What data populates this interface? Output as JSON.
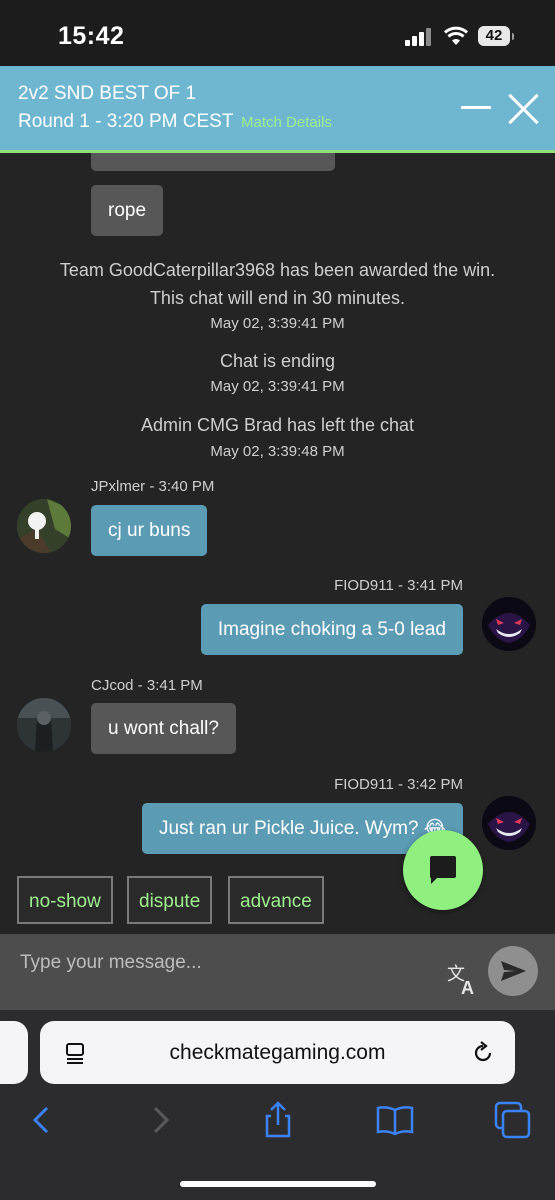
{
  "status_bar": {
    "time": "15:42",
    "battery": "42"
  },
  "header": {
    "title": "2v2 SND BEST OF 1",
    "round": "Round 1 - 3:20 PM CEST",
    "details_link": "Match Details"
  },
  "messages": {
    "rope": "rope",
    "sys_win_line1": "Team GoodCaterpillar3968 has been awarded the win.",
    "sys_win_line2": "This chat will end in 30 minutes.",
    "sys_win_ts": "May 02, 3:39:41 PM",
    "sys_ending": "Chat is ending",
    "sys_ending_ts": "May 02, 3:39:41 PM",
    "sys_left": "Admin CMG Brad has left the chat",
    "sys_left_ts": "May 02, 3:39:48 PM",
    "m1_meta": "JPxlmer - 3:40 PM",
    "m1_text": "cj ur buns",
    "m2_meta": "FIOD911 - 3:41 PM",
    "m2_text": "Imagine choking a 5-0 lead",
    "m3_meta": "CJcod - 3:41 PM",
    "m3_text": "u wont chall?",
    "m4_meta": "FIOD911 - 3:42 PM",
    "m4_text": "Just ran ur Pickle Juice. Wym? 😂"
  },
  "quick_actions": [
    "no-show",
    "dispute",
    "advance"
  ],
  "composer": {
    "placeholder": "Type your message..."
  },
  "browser": {
    "url": "checkmategaming.com"
  },
  "colors": {
    "header_bg": "#6fb6d0",
    "accent_green": "#8ff080",
    "bubble_blue": "#5b9bb4",
    "bubble_grey": "#575757"
  },
  "icons": [
    "signal-icon",
    "wifi-icon",
    "battery-icon",
    "minimize-icon",
    "close-icon",
    "chat-bubble-icon",
    "translate-icon",
    "send-icon",
    "reader-icon",
    "reload-icon",
    "back-icon",
    "forward-icon",
    "share-icon",
    "bookmarks-icon",
    "tabs-icon"
  ]
}
